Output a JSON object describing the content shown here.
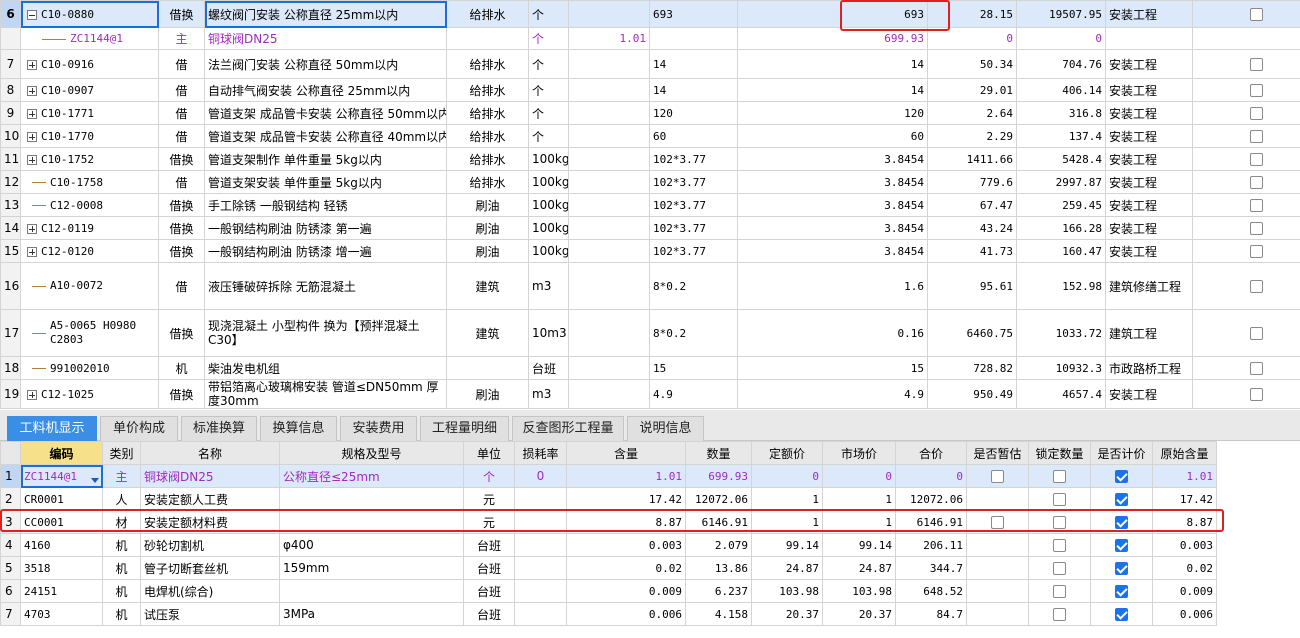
{
  "top_rows": [
    {
      "rn": "6",
      "toggle": "minus",
      "code": "C10-0880",
      "type": "借换",
      "name": "螺纹阀门安装 公称直径 25mm以内",
      "major": "给排水",
      "unit": "个",
      "coef": "",
      "qty_expr": "693",
      "qty": "693",
      "price": "28.15",
      "total": "19507.95",
      "category": "安装工程",
      "selected": true
    },
    {
      "rn": "",
      "toggle": "line2",
      "code": "ZC1144@1",
      "type": "主",
      "name": "铜球阀DN25",
      "major": "",
      "unit": "个",
      "coef": "1.01",
      "qty_expr": "",
      "qty": "699.93",
      "price": "0",
      "total": "0",
      "category": "",
      "sub": true
    },
    {
      "rn": "7",
      "toggle": "plus",
      "code": "C10-0916",
      "type": "借",
      "name": "法兰阀门安装 公称直径 50mm以内",
      "major": "给排水",
      "unit": "个",
      "coef": "",
      "qty_expr": "14",
      "qty": "14",
      "price": "50.34",
      "total": "704.76",
      "category": "安装工程"
    },
    {
      "rn": "8",
      "toggle": "plus",
      "code": "C10-0907",
      "type": "借",
      "name": "自动排气阀安装 公称直径 25mm以内",
      "major": "给排水",
      "unit": "个",
      "coef": "",
      "qty_expr": "14",
      "qty": "14",
      "price": "29.01",
      "total": "406.14",
      "category": "安装工程"
    },
    {
      "rn": "9",
      "toggle": "plus",
      "code": "C10-1771",
      "type": "借",
      "name": "管道支架 成品管卡安装 公称直径 50mm以内",
      "major": "给排水",
      "unit": "个",
      "coef": "",
      "qty_expr": "120",
      "qty": "120",
      "price": "2.64",
      "total": "316.8",
      "category": "安装工程"
    },
    {
      "rn": "10",
      "toggle": "plus",
      "code": "C10-1770",
      "type": "借",
      "name": "管道支架 成品管卡安装 公称直径 40mm以内",
      "major": "给排水",
      "unit": "个",
      "coef": "",
      "qty_expr": "60",
      "qty": "60",
      "price": "2.29",
      "total": "137.4",
      "category": "安装工程"
    },
    {
      "rn": "11",
      "toggle": "plus",
      "code": "C10-1752",
      "type": "借换",
      "name": "管道支架制作 单件重量 5kg以内",
      "major": "给排水",
      "unit": "100kg",
      "coef": "",
      "qty_expr": "102*3.77",
      "qty": "3.8454",
      "price": "1411.66",
      "total": "5428.4",
      "category": "安装工程"
    },
    {
      "rn": "12",
      "toggle": "line",
      "code": "C10-1758",
      "type": "借",
      "name": "管道支架安装 单件重量 5kg以内",
      "major": "给排水",
      "unit": "100kg",
      "coef": "",
      "qty_expr": "102*3.77",
      "qty": "3.8454",
      "price": "779.6",
      "total": "2997.87",
      "category": "安装工程"
    },
    {
      "rn": "13",
      "toggle": "line",
      "code": "C12-0008",
      "type": "借换",
      "name": "手工除锈 一般钢结构 轻锈",
      "major": "刷油",
      "unit": "100kg",
      "coef": "",
      "qty_expr": "102*3.77",
      "qty": "3.8454",
      "price": "67.47",
      "total": "259.45",
      "category": "安装工程"
    },
    {
      "rn": "14",
      "toggle": "plus",
      "code": "C12-0119",
      "type": "借换",
      "name": "一般钢结构刷油 防锈漆 第一遍",
      "major": "刷油",
      "unit": "100kg",
      "coef": "",
      "qty_expr": "102*3.77",
      "qty": "3.8454",
      "price": "43.24",
      "total": "166.28",
      "category": "安装工程"
    },
    {
      "rn": "15",
      "toggle": "plus",
      "code": "C12-0120",
      "type": "借换",
      "name": "一般钢结构刷油 防锈漆 增一遍",
      "major": "刷油",
      "unit": "100kg",
      "coef": "",
      "qty_expr": "102*3.77",
      "qty": "3.8454",
      "price": "41.73",
      "total": "160.47",
      "category": "安装工程"
    },
    {
      "rn": "16",
      "toggle": "line",
      "code": "A10-0072",
      "type": "借",
      "name": "液压锤破碎拆除 无筋混凝土",
      "major": "建筑",
      "unit": "m3",
      "coef": "",
      "qty_expr": "8*0.2",
      "qty": "1.6",
      "price": "95.61",
      "total": "152.98",
      "category": "建筑修缮工程",
      "tall": true
    },
    {
      "rn": "17",
      "toggle": "line",
      "code": "A5-0065 H0980 C2803",
      "type": "借换",
      "name": "现浇混凝土 小型构件  换为【预拌混凝土 C30】",
      "major": "建筑",
      "unit": "10m3",
      "coef": "",
      "qty_expr": "8*0.2",
      "qty": "0.16",
      "price": "6460.75",
      "total": "1033.72",
      "category": "建筑工程",
      "tall": true
    },
    {
      "rn": "18",
      "toggle": "line",
      "code": "991002010",
      "type": "机",
      "name": "柴油发电机组",
      "major": "",
      "unit": "台班",
      "coef": "",
      "qty_expr": "15",
      "qty": "15",
      "price": "728.82",
      "total": "10932.3",
      "category": "市政路桥工程"
    },
    {
      "rn": "19",
      "toggle": "plus",
      "code": "C12-1025",
      "type": "借换",
      "name": "带铝箔离心玻璃棉安装 管道≤DN50mm 厚度30mm",
      "major": "刷油",
      "unit": "m3",
      "coef": "",
      "qty_expr": "4.9",
      "qty": "4.9",
      "price": "950.49",
      "total": "4657.4",
      "category": "安装工程",
      "tall2": true
    }
  ],
  "tabs": [
    "工料机显示",
    "单价构成",
    "标准换算",
    "换算信息",
    "安装费用",
    "工程量明细",
    "反查图形工程量",
    "说明信息"
  ],
  "bottom_headers": [
    "编码",
    "类别",
    "名称",
    "规格及型号",
    "单位",
    "损耗率",
    "含量",
    "数量",
    "定额价",
    "市场价",
    "合价",
    "是否暂估",
    "锁定数量",
    "是否计价",
    "原始含量"
  ],
  "bottom_rows": [
    {
      "rn": "1",
      "code": "ZC1144@1",
      "type": "主",
      "name": "铜球阀DN25",
      "spec": "公称直径≤25mm",
      "unit": "个",
      "loss": "0",
      "content": "1.01",
      "qty": "699.93",
      "base": "0",
      "market": "0",
      "total": "0",
      "est": true,
      "lock": true,
      "priced": true,
      "orig": "1.01",
      "selected": true
    },
    {
      "rn": "2",
      "code": "CR0001",
      "type": "人",
      "name": "安装定额人工费",
      "spec": "",
      "unit": "元",
      "loss": "",
      "content": "17.42",
      "qty": "12072.06",
      "base": "1",
      "market": "1",
      "total": "12072.06",
      "est": false,
      "lock": true,
      "priced": true,
      "orig": "17.42"
    },
    {
      "rn": "3",
      "code": "CC0001",
      "type": "材",
      "name": "安装定额材料费",
      "spec": "",
      "unit": "元",
      "loss": "",
      "content": "8.87",
      "qty": "6146.91",
      "base": "1",
      "market": "1",
      "total": "6146.91",
      "est": true,
      "lock": true,
      "priced": true,
      "orig": "8.87"
    },
    {
      "rn": "4",
      "code": "4160",
      "type": "机",
      "name": "砂轮切割机",
      "spec": "φ400",
      "unit": "台班",
      "loss": "",
      "content": "0.003",
      "qty": "2.079",
      "base": "99.14",
      "market": "99.14",
      "total": "206.11",
      "est": false,
      "lock": true,
      "priced": true,
      "orig": "0.003"
    },
    {
      "rn": "5",
      "code": "3518",
      "type": "机",
      "name": "管子切断套丝机",
      "spec": "159mm",
      "unit": "台班",
      "loss": "",
      "content": "0.02",
      "qty": "13.86",
      "base": "24.87",
      "market": "24.87",
      "total": "344.7",
      "est": false,
      "lock": true,
      "priced": true,
      "orig": "0.02"
    },
    {
      "rn": "6",
      "code": "24151",
      "type": "机",
      "name": "电焊机(综合)",
      "spec": "",
      "unit": "台班",
      "loss": "",
      "content": "0.009",
      "qty": "6.237",
      "base": "103.98",
      "market": "103.98",
      "total": "648.52",
      "est": false,
      "lock": true,
      "priced": true,
      "orig": "0.009"
    },
    {
      "rn": "7",
      "code": "4703",
      "type": "机",
      "name": "试压泵",
      "spec": "3MPa",
      "unit": "台班",
      "loss": "",
      "content": "0.006",
      "qty": "4.158",
      "base": "20.37",
      "market": "20.37",
      "total": "84.7",
      "est": false,
      "lock": true,
      "priced": true,
      "orig": "0.006"
    }
  ]
}
